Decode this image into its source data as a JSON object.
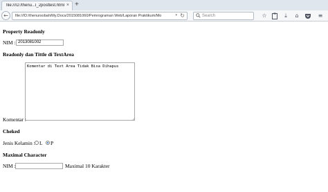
{
  "browser": {
    "tab_title": "file:///D:/thenu...l_2posttest.html",
    "tab_close": "×",
    "new_tab": "+",
    "url": "file:///D:/thenursobah/My.Docs/2015081060/Pemrograman Web/Laporan Praktikum/Mo",
    "url_dropdown": "▾",
    "reload": "↻",
    "search_placeholder": "Search",
    "icons": [
      "star-icon",
      "clipboard-icon",
      "download-icon",
      "home-icon",
      "pocket-icon",
      "menu-icon"
    ]
  },
  "page": {
    "section1": {
      "heading": "Property Readonly",
      "nim_label": "NIM :",
      "nim_value": "2013081002"
    },
    "section2": {
      "heading": "Readonly dan Tittle di TextArea",
      "komentar_label": "Komentar :",
      "textarea_value": "Komentar di Text Area Tidak Bisa Dihapus"
    },
    "section3": {
      "heading": "Cheked",
      "jk_label": "Jenis Kelamin :",
      "option_l": "L",
      "option_p": "P",
      "selected": "P"
    },
    "section4": {
      "heading": "Maximal Character",
      "nim_label": "NIM :",
      "nim_value": "",
      "hint": "Maximal 10 Karakter"
    }
  }
}
